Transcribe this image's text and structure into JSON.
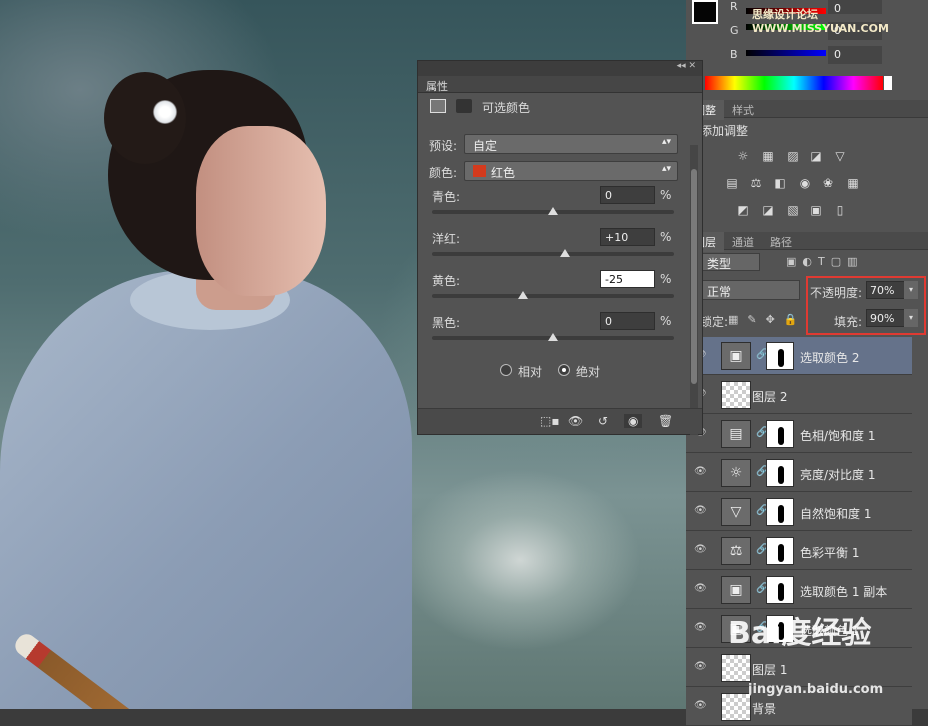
{
  "watermark_top": "思缘设计论坛 WWW.MISSYUAN.COM",
  "watermark_bottom_main": "Bai度经验",
  "watermark_bottom_url": "jingyan.baidu.com",
  "colors": {
    "labels": [
      "R",
      "G",
      "B"
    ],
    "values": [
      "0",
      "0",
      "0"
    ]
  },
  "adjust_panel": {
    "tabs": [
      "调整",
      "样式"
    ],
    "title": "添加调整"
  },
  "layers_panel": {
    "tabs": [
      "图层",
      "通道",
      "路径"
    ],
    "filter_label": "类型",
    "blend_mode": "正常",
    "opacity_label": "不透明度:",
    "opacity_value": "70%",
    "lock_label": "锁定:",
    "fill_label": "填充:",
    "fill_value": "90%",
    "layers": [
      {
        "name": "选取颜色 2",
        "icon": "selective-color-icon",
        "selected": true
      },
      {
        "name": "图层 2",
        "icon": "layer-thumb"
      },
      {
        "name": "色相/饱和度 1",
        "icon": "hue-saturation-icon"
      },
      {
        "name": "亮度/对比度 1",
        "icon": "brightness-icon"
      },
      {
        "name": "自然饱和度 1",
        "icon": "vibrance-icon"
      },
      {
        "name": "色彩平衡 1",
        "icon": "color-balance-icon"
      },
      {
        "name": "选取颜色 1 副本",
        "icon": "selective-color-icon"
      },
      {
        "name": "选取颜色 1",
        "icon": "selective-color-icon"
      },
      {
        "name": "图层 1",
        "icon": "layer-thumb"
      },
      {
        "name": "背景",
        "icon": "layer-thumb"
      }
    ]
  },
  "properties": {
    "tab": "属性",
    "title": "可选颜色",
    "preset_label": "预设:",
    "preset_value": "自定",
    "color_label": "颜色:",
    "color_value": "红色",
    "color_swatch": "#d33a1d",
    "sliders": [
      {
        "label": "青色:",
        "value": "0",
        "level": 0.5
      },
      {
        "label": "洋红:",
        "value": "+10",
        "level": 0.55
      },
      {
        "label": "黄色:",
        "value": "-25",
        "level": 0.375
      },
      {
        "label": "黑色:",
        "value": "0",
        "level": 0.5
      }
    ],
    "percent": "%",
    "mode_relative": "相对",
    "mode_absolute": "绝对",
    "mode_selected": "absolute"
  }
}
